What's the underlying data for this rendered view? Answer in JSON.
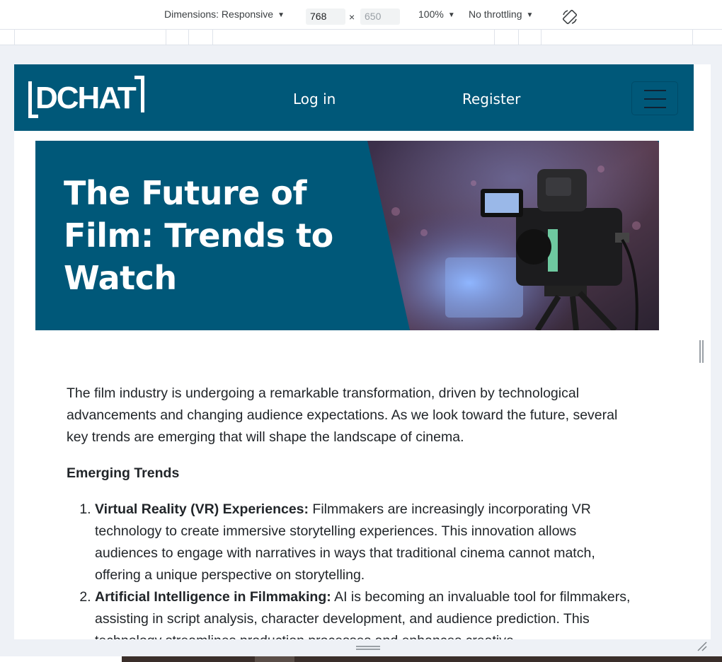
{
  "devtools": {
    "dimensions_label": "Dimensions: Responsive",
    "width_value": "768",
    "height_placeholder": "650",
    "times_symbol": "×",
    "zoom": "100%",
    "throttling": "No throttling"
  },
  "site": {
    "logo_text": "DCHAT",
    "nav": {
      "login": "Log in",
      "register": "Register"
    },
    "colors": {
      "primary": "#005879",
      "text": "#212529"
    }
  },
  "hero": {
    "title": "The Future of Film: Trends to Watch"
  },
  "article": {
    "intro": "The film industry is undergoing a remarkable transformation, driven by technological advancements and changing audience expectations. As we look toward the future, several key trends are emerging that will shape the landscape of cinema.",
    "section_heading": "Emerging Trends",
    "trends": [
      {
        "title": "Virtual Reality (VR) Experiences:",
        "text": " Filmmakers are increasingly incorporating VR technology to create immersive storytelling experiences. This innovation allows audiences to engage with narratives in ways that traditional cinema cannot match, offering a unique perspective on storytelling."
      },
      {
        "title": "Artificial Intelligence in Filmmaking:",
        "text": " AI is becoming an invaluable tool for filmmakers, assisting in script analysis, character development, and audience prediction. This technology streamlines production processes and enhances creative"
      }
    ]
  }
}
